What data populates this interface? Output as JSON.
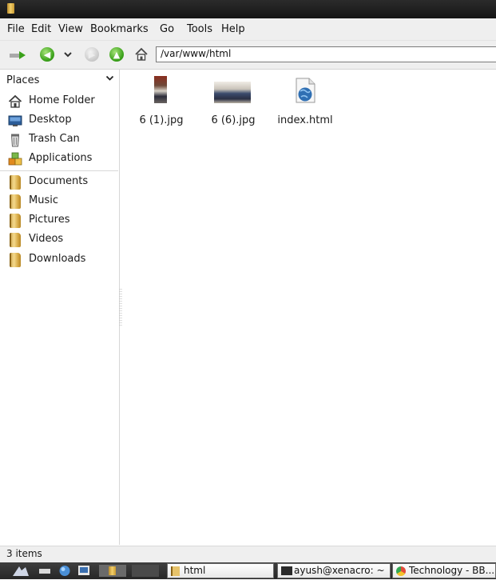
{
  "menubar": {
    "items": [
      "File",
      "Edit",
      "View",
      "Bookmarks",
      "Go",
      "Tools",
      "Help"
    ]
  },
  "toolbar": {
    "location": "/var/www/html"
  },
  "sidebar": {
    "header": "Places",
    "items": [
      {
        "label": "Home Folder",
        "icon": "home-icon"
      },
      {
        "label": "Desktop",
        "icon": "desktop-icon"
      },
      {
        "label": "Trash Can",
        "icon": "trash-icon"
      },
      {
        "label": "Applications",
        "icon": "applications-icon"
      },
      {
        "label": "Documents",
        "icon": "folder-icon"
      },
      {
        "label": "Music",
        "icon": "folder-icon"
      },
      {
        "label": "Pictures",
        "icon": "folder-icon"
      },
      {
        "label": "Videos",
        "icon": "folder-icon"
      },
      {
        "label": "Downloads",
        "icon": "folder-icon"
      }
    ]
  },
  "files": [
    {
      "name": "6 (1).jpg",
      "icon": "image-thumbnail"
    },
    {
      "name": "6 (6).jpg",
      "icon": "image-thumbnail"
    },
    {
      "name": "index.html",
      "icon": "html-document-icon"
    }
  ],
  "status": {
    "text": "3 items"
  },
  "taskbar": {
    "tasks": [
      {
        "label": "html"
      },
      {
        "label": "ayush@xenacro: ~"
      },
      {
        "label": "Technology - BB..."
      }
    ]
  },
  "colors": {
    "accent_green": "#3aa11a",
    "folder": "#e0b24e",
    "taskbar": "#2e2e2e"
  }
}
